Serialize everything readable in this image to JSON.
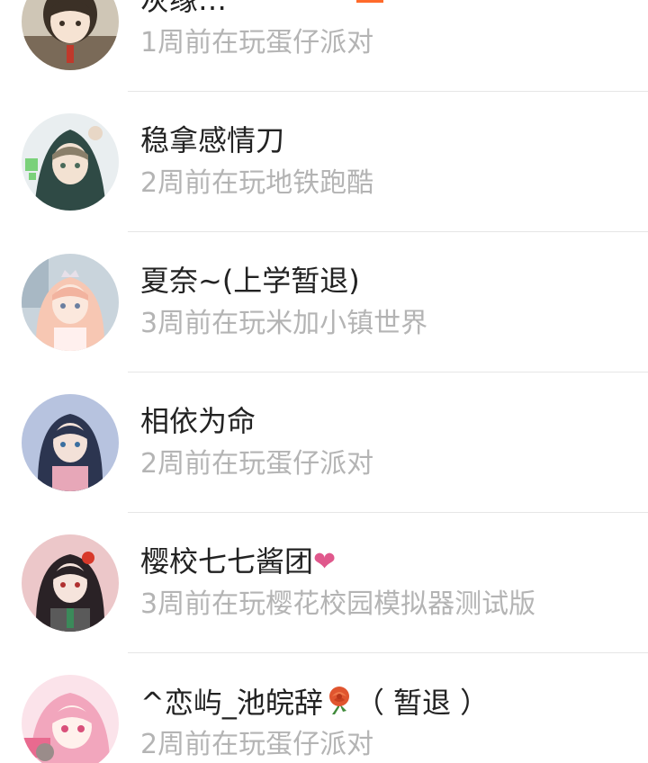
{
  "contacts": [
    {
      "name": "灰缘…",
      "status": "1周前在玩蛋仔派对"
    },
    {
      "name": "稳拿感情刀",
      "status": "2周前在玩地铁跑酷"
    },
    {
      "name": "夏奈~(上学暂退)",
      "status": "3周前在玩米加小镇世界"
    },
    {
      "name": "相依为命",
      "status": "2周前在玩蛋仔派对"
    },
    {
      "name": "樱校七七酱团",
      "status": "3周前在玩樱花校园模拟器测试版"
    },
    {
      "name": "^恋屿_池皖辞",
      "name_suffix": "（ 暂退 ）",
      "status": "2周前在玩蛋仔派对"
    }
  ],
  "colors": {
    "name_text": "#222222",
    "status_text": "#b4b4b4",
    "divider": "#e6e6e6",
    "heart": "#e0588c",
    "accent": "#ff6a2b"
  },
  "icons": {
    "row5_trailing": "heart-icon",
    "row6_trailing": "rose-icon"
  }
}
